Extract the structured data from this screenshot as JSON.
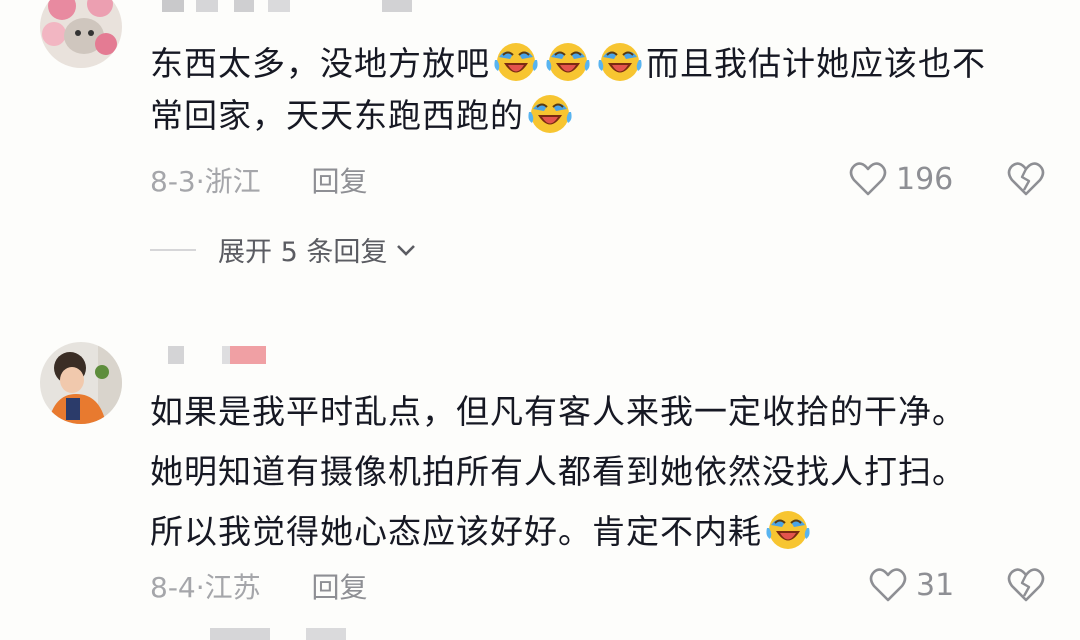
{
  "comments": [
    {
      "lines": [
        "东西太多，没地方放吧",
        "而且我估计她应该也不",
        "常回家，天天东跑西跑的"
      ],
      "date_location": "8-3·浙江",
      "reply_label": "回复",
      "like_count": "196"
    },
    {
      "lines": [
        "如果是我平时乱点，但凡有客人来我一定收拾的干净。",
        "她明知道有摄像机拍所有人都看到她依然没找人打扫。",
        "所以我觉得她心态应该好好。肯定不内耗"
      ],
      "date_location": "8-4·江苏",
      "reply_label": "回复",
      "like_count": "31"
    }
  ],
  "expand_replies": "展开 5 条回复",
  "icons": {
    "emoji": "laughing-crying-emoji-icon",
    "like": "heart-outline-icon",
    "dislike": "broken-heart-icon",
    "expand": "chevron-down-icon"
  },
  "colors": {
    "background": "#fdfdfb",
    "text": "#161823",
    "meta": "#a5a6aa"
  }
}
